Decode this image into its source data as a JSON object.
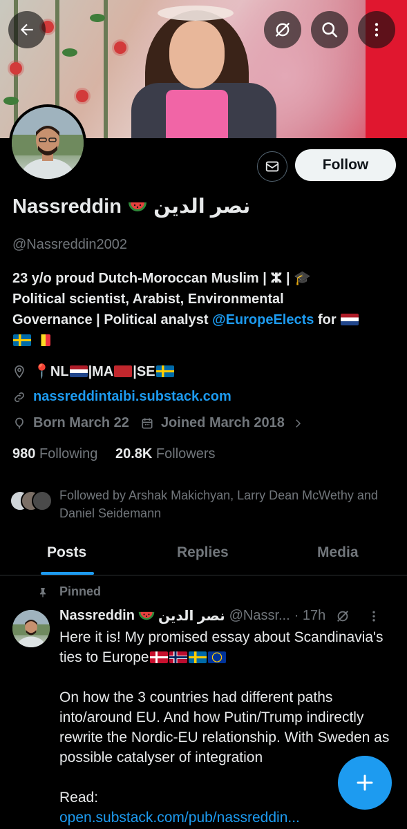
{
  "header": {
    "back_icon": "arrow-left-icon",
    "menu_icons": [
      "grok-slash-icon",
      "search-icon",
      "more-vertical-icon"
    ]
  },
  "profile": {
    "name_en": "Nassreddin",
    "name_ar": "نصر الدين",
    "handle": "@Nassreddin2002",
    "follow_label": "Follow",
    "bio_line1": "23 y/o proud Dutch-Moroccan Muslim | ⵣ | 🎓",
    "bio_line2": "Political scientist, Arabist, Environmental",
    "bio_line3_prefix": "Governance | Political analyst",
    "bio_mention": "@EuropeElects",
    "bio_for": "for",
    "location_pin": "📍",
    "location_parts": [
      "NL",
      "|MA",
      "|SE"
    ],
    "website": "nassreddintaibi.substack.com",
    "born": "Born March 22",
    "joined": "Joined March 2018",
    "following_count": "980",
    "following_label": "Following",
    "followers_count": "20.8K",
    "followers_label": "Followers",
    "followed_by": "Followed by Arshak Makichyan, Larry Dean McWethy and Daniel Seidemann"
  },
  "tabs": [
    "Posts",
    "Replies",
    "Media"
  ],
  "pinned_post": {
    "pinned_label": "Pinned",
    "author": "Nassreddin",
    "author_ar": "نصر الدين",
    "handle": "@Nassr...",
    "time": "· 17h",
    "para1": "Here it is! My promised essay about Scandinavia's ties to Europe",
    "para2": "On how the 3 countries had different paths into/around EU. And how Putin/Trump indirectly rewrite the Nordic-EU relationship. With Sweden as possible catalyser of integration",
    "read_label": "Read:",
    "link": "open.substack.com/pub/nassreddin..."
  },
  "colors": {
    "accent": "#1d9bf0",
    "secondary_text": "#71767b",
    "primary_text": "#e7e9ea",
    "background": "#000000"
  }
}
